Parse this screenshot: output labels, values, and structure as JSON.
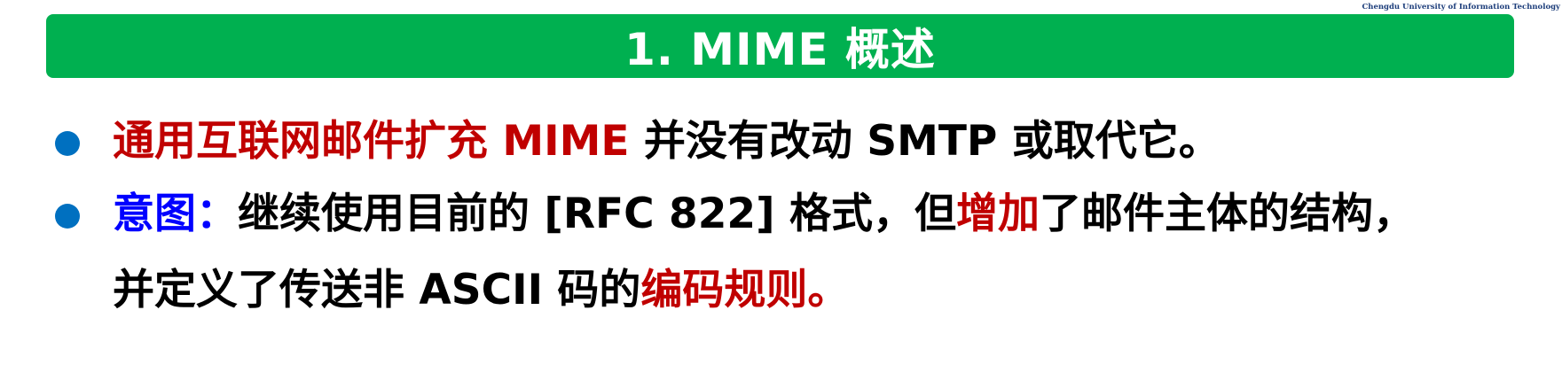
{
  "header": {
    "logo_text": "Chengdu University of Information Technology"
  },
  "title": "1. MIME 概述",
  "bullets": [
    {
      "segments": [
        {
          "text": "通用互联网邮件扩充 MIME",
          "color": "red"
        },
        {
          "text": " 并没有改动 SMTP 或取代它。",
          "color": "black"
        }
      ]
    },
    {
      "segments": [
        {
          "text": "意图：",
          "color": "blue"
        },
        {
          "text": "继续使用目前的 [RFC 822] 格式，但",
          "color": "black"
        },
        {
          "text": "增加",
          "color": "red"
        },
        {
          "text": "了邮件主体的结构，",
          "color": "black"
        }
      ],
      "continuation": [
        {
          "text": "并定义了传送非 ASCII 码的",
          "color": "black"
        },
        {
          "text": "编码规则。",
          "color": "red"
        }
      ]
    }
  ],
  "colors": {
    "title_bg": "#00b050",
    "bullet": "#0070c0",
    "red": "#c00000",
    "blue": "#0000ff",
    "black": "#000000"
  }
}
